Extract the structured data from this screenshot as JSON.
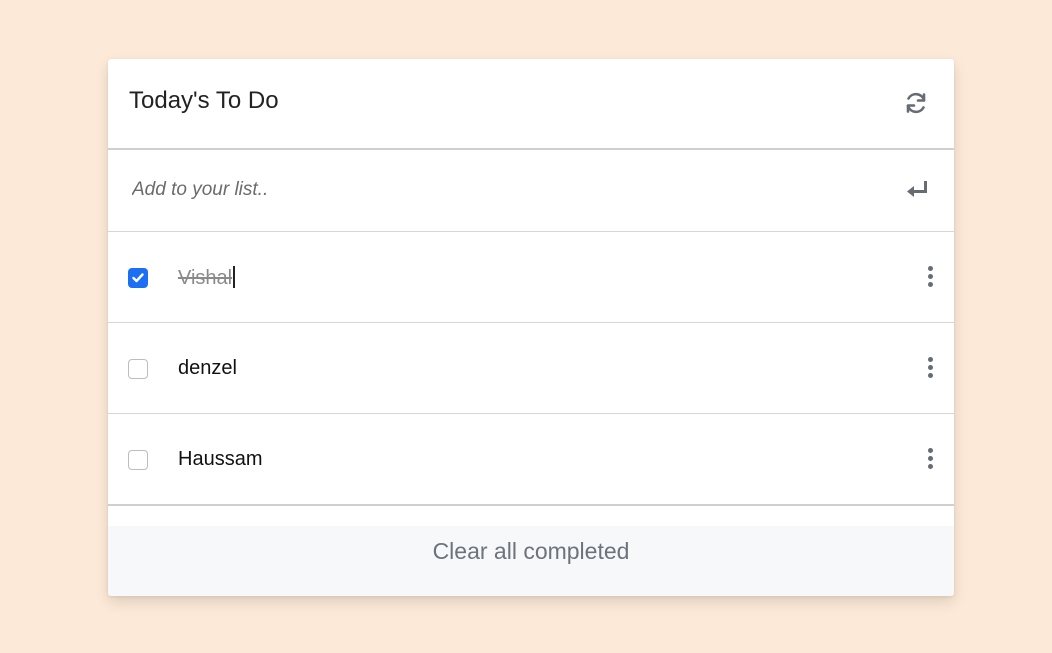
{
  "header": {
    "title": "Today's To Do",
    "refresh_icon": "refresh-icon"
  },
  "add": {
    "placeholder": "Add to your list..",
    "enter_icon": "enter-icon"
  },
  "todos": [
    {
      "text": "Vishal",
      "completed": true
    },
    {
      "text": "denzel",
      "completed": false
    },
    {
      "text": "Haussam",
      "completed": false
    }
  ],
  "footer": {
    "clear_label": "Clear all completed"
  },
  "colors": {
    "background": "#fde9d7",
    "accent": "#1a6ff5",
    "icon": "#666c74"
  }
}
